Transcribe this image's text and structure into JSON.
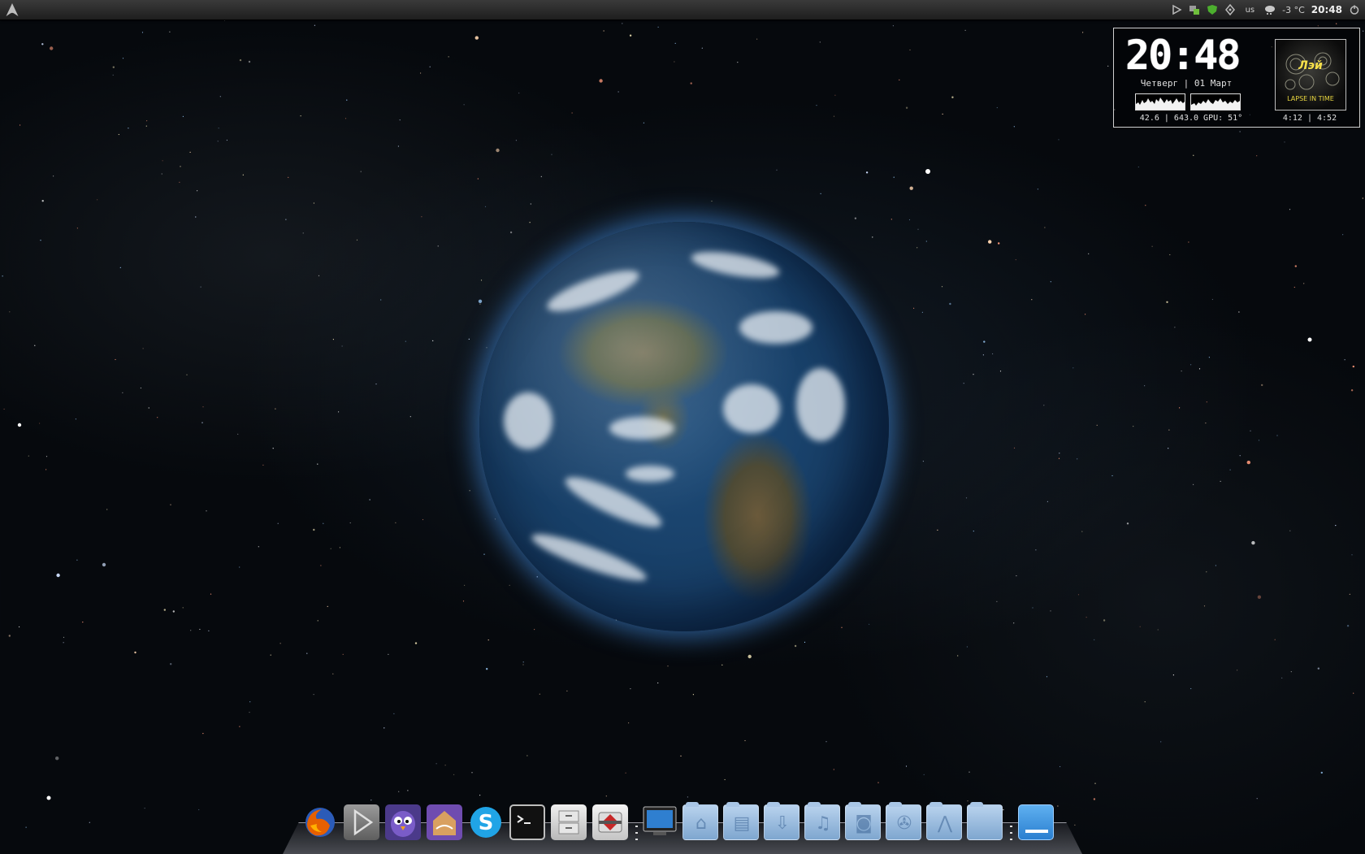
{
  "top_panel": {
    "keyboard_layout": "us",
    "weather": "-3 °C",
    "clock": "20:48"
  },
  "conky": {
    "time": "20:48",
    "date": "Четверг | 01 Март",
    "stats": "42.6 | 643.0  GPU: 51°",
    "track_times": "4:12 | 4:52",
    "album_logo": "Лэй",
    "album_subtitle": "LAPSE IN TIME"
  },
  "dock": {
    "apps": [
      {
        "name": "firefox",
        "icon": "firefox-icon",
        "color": "#e66000"
      },
      {
        "name": "media-player",
        "icon": "play-icon",
        "color": "#8a8a8a"
      },
      {
        "name": "pidgin",
        "icon": "pidgin-icon",
        "color": "#6a4aa8"
      },
      {
        "name": "arabic-app",
        "icon": "app-icon",
        "color": "#8a5cc0"
      },
      {
        "name": "skype",
        "icon": "skype-icon",
        "color": "#20a4e6"
      },
      {
        "name": "terminal",
        "icon": "terminal-icon",
        "color": "#111111"
      },
      {
        "name": "file-cabinet",
        "icon": "cabinet-icon",
        "color": "#d6d6d6"
      },
      {
        "name": "transmission",
        "icon": "transmission-icon",
        "color": "#c62828"
      }
    ],
    "places": [
      {
        "name": "computer",
        "icon": "monitor-icon"
      },
      {
        "name": "home",
        "icon": "home-icon"
      },
      {
        "name": "documents",
        "icon": "documents-icon"
      },
      {
        "name": "downloads",
        "icon": "download-icon"
      },
      {
        "name": "music",
        "icon": "music-icon"
      },
      {
        "name": "pictures",
        "icon": "camera-icon"
      },
      {
        "name": "videos",
        "icon": "video-icon"
      },
      {
        "name": "templates",
        "icon": "compass-icon"
      },
      {
        "name": "folder",
        "icon": "folder-icon"
      },
      {
        "name": "trash",
        "icon": "desktop-icon"
      }
    ]
  },
  "colors": {
    "accent_folder": "#9ebfe0",
    "earth_ocean": "#1f4d7a",
    "glow": "#5aaaff"
  }
}
